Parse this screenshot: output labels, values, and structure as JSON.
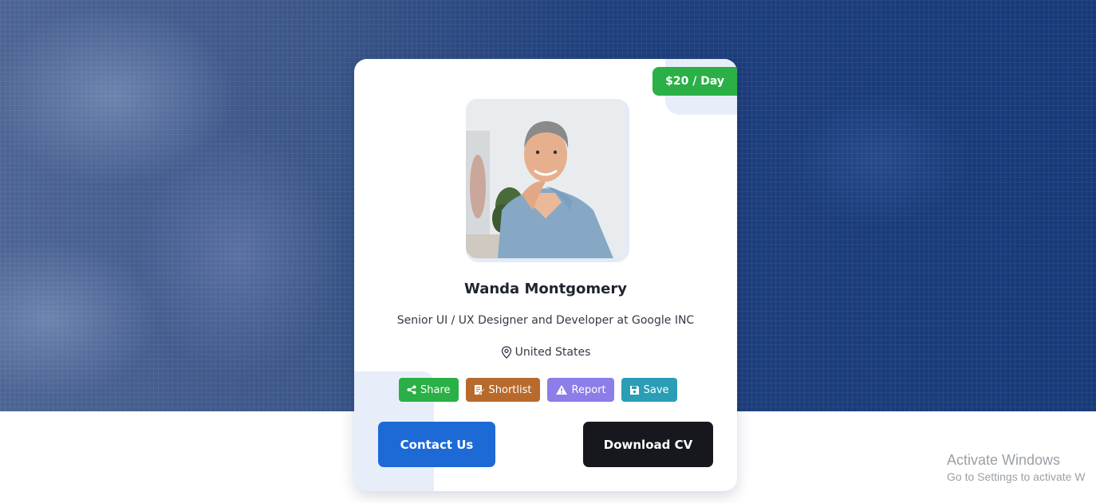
{
  "profile": {
    "rate": "$20 / Day",
    "name": "Wanda Montgomery",
    "role": "Senior UI / UX Designer and Developer at Google INC",
    "location": "United States",
    "avatar_icon": "profile-photo"
  },
  "actions": {
    "share": "Share",
    "shortlist": "Shortlist",
    "report": "Report",
    "save": "Save"
  },
  "buttons": {
    "contact": "Contact Us",
    "download": "Download CV"
  },
  "watermark": {
    "title": "Activate Windows",
    "subtitle": "Go to Settings to activate W"
  },
  "colors": {
    "rate_badge": "#2ab046",
    "share": "#2ab046",
    "shortlist": "#b86a2c",
    "report": "#8b7ee8",
    "save": "#2a9eb5",
    "contact": "#1d6ad6",
    "download": "#17181d",
    "hero": "#1f3f7c"
  }
}
